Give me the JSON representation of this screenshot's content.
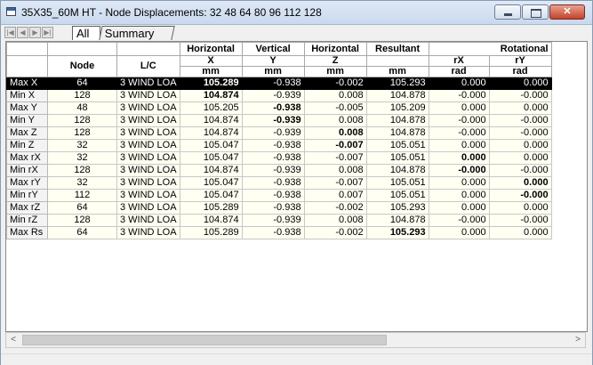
{
  "window": {
    "title": "35X35_60M HT - Node Displacements: 32 48 64 80 96 112 128"
  },
  "tabs": {
    "all": "All",
    "summary": "Summary"
  },
  "nav_icons": [
    "first-icon",
    "prev-icon",
    "next-icon",
    "last-icon"
  ],
  "table": {
    "group_headers": [
      "Horizontal",
      "Vertical",
      "Horizontal",
      "Resultant",
      "Rotational"
    ],
    "col_headers": [
      "Node",
      "L/C"
    ],
    "symbols": [
      "X",
      "Y",
      "Z",
      "",
      "rX",
      "rY"
    ],
    "units": [
      "mm",
      "mm",
      "mm",
      "mm",
      "rad",
      "rad"
    ],
    "rows": [
      [
        "Max X",
        "64",
        "3 WIND LOA",
        "105.289",
        "-0.938",
        "-0.002",
        "105.293",
        "0.000",
        "0.000"
      ],
      [
        "Min X",
        "128",
        "3 WIND LOA",
        "104.874",
        "-0.939",
        "0.008",
        "104.878",
        "-0.000",
        "-0.000"
      ],
      [
        "Max Y",
        "48",
        "3 WIND LOA",
        "105.205",
        "-0.938",
        "-0.005",
        "105.209",
        "0.000",
        "0.000"
      ],
      [
        "Min Y",
        "128",
        "3 WIND LOA",
        "104.874",
        "-0.939",
        "0.008",
        "104.878",
        "-0.000",
        "-0.000"
      ],
      [
        "Max Z",
        "128",
        "3 WIND LOA",
        "104.874",
        "-0.939",
        "0.008",
        "104.878",
        "-0.000",
        "-0.000"
      ],
      [
        "Min Z",
        "32",
        "3 WIND LOA",
        "105.047",
        "-0.938",
        "-0.007",
        "105.051",
        "0.000",
        "0.000"
      ],
      [
        "Max rX",
        "32",
        "3 WIND LOA",
        "105.047",
        "-0.938",
        "-0.007",
        "105.051",
        "0.000",
        "0.000"
      ],
      [
        "Min rX",
        "128",
        "3 WIND LOA",
        "104.874",
        "-0.939",
        "0.008",
        "104.878",
        "-0.000",
        "-0.000"
      ],
      [
        "Max rY",
        "32",
        "3 WIND LOA",
        "105.047",
        "-0.938",
        "-0.007",
        "105.051",
        "0.000",
        "0.000"
      ],
      [
        "Min rY",
        "112",
        "3 WIND LOA",
        "105.047",
        "-0.938",
        "0.007",
        "105.051",
        "0.000",
        "-0.000"
      ],
      [
        "Max rZ",
        "64",
        "3 WIND LOA",
        "105.289",
        "-0.938",
        "-0.002",
        "105.293",
        "0.000",
        "0.000"
      ],
      [
        "Min rZ",
        "128",
        "3 WIND LOA",
        "104.874",
        "-0.939",
        "0.008",
        "104.878",
        "-0.000",
        "-0.000"
      ],
      [
        "Max Rs",
        "64",
        "3 WIND LOA",
        "105.289",
        "-0.938",
        "-0.002",
        "105.293",
        "0.000",
        "0.000"
      ]
    ],
    "bold_cells": [
      [
        0,
        3
      ],
      [
        1,
        3
      ],
      [
        2,
        4
      ],
      [
        3,
        4
      ],
      [
        4,
        5
      ],
      [
        5,
        5
      ],
      [
        6,
        7
      ],
      [
        7,
        7
      ],
      [
        8,
        8
      ],
      [
        9,
        8
      ],
      [
        12,
        6
      ]
    ],
    "selected_row": 0
  },
  "scrollbar": {
    "left_icon": "arrow-left-icon",
    "right_icon": "arrow-right-icon",
    "left_glyph": "<",
    "right_glyph": ">"
  }
}
